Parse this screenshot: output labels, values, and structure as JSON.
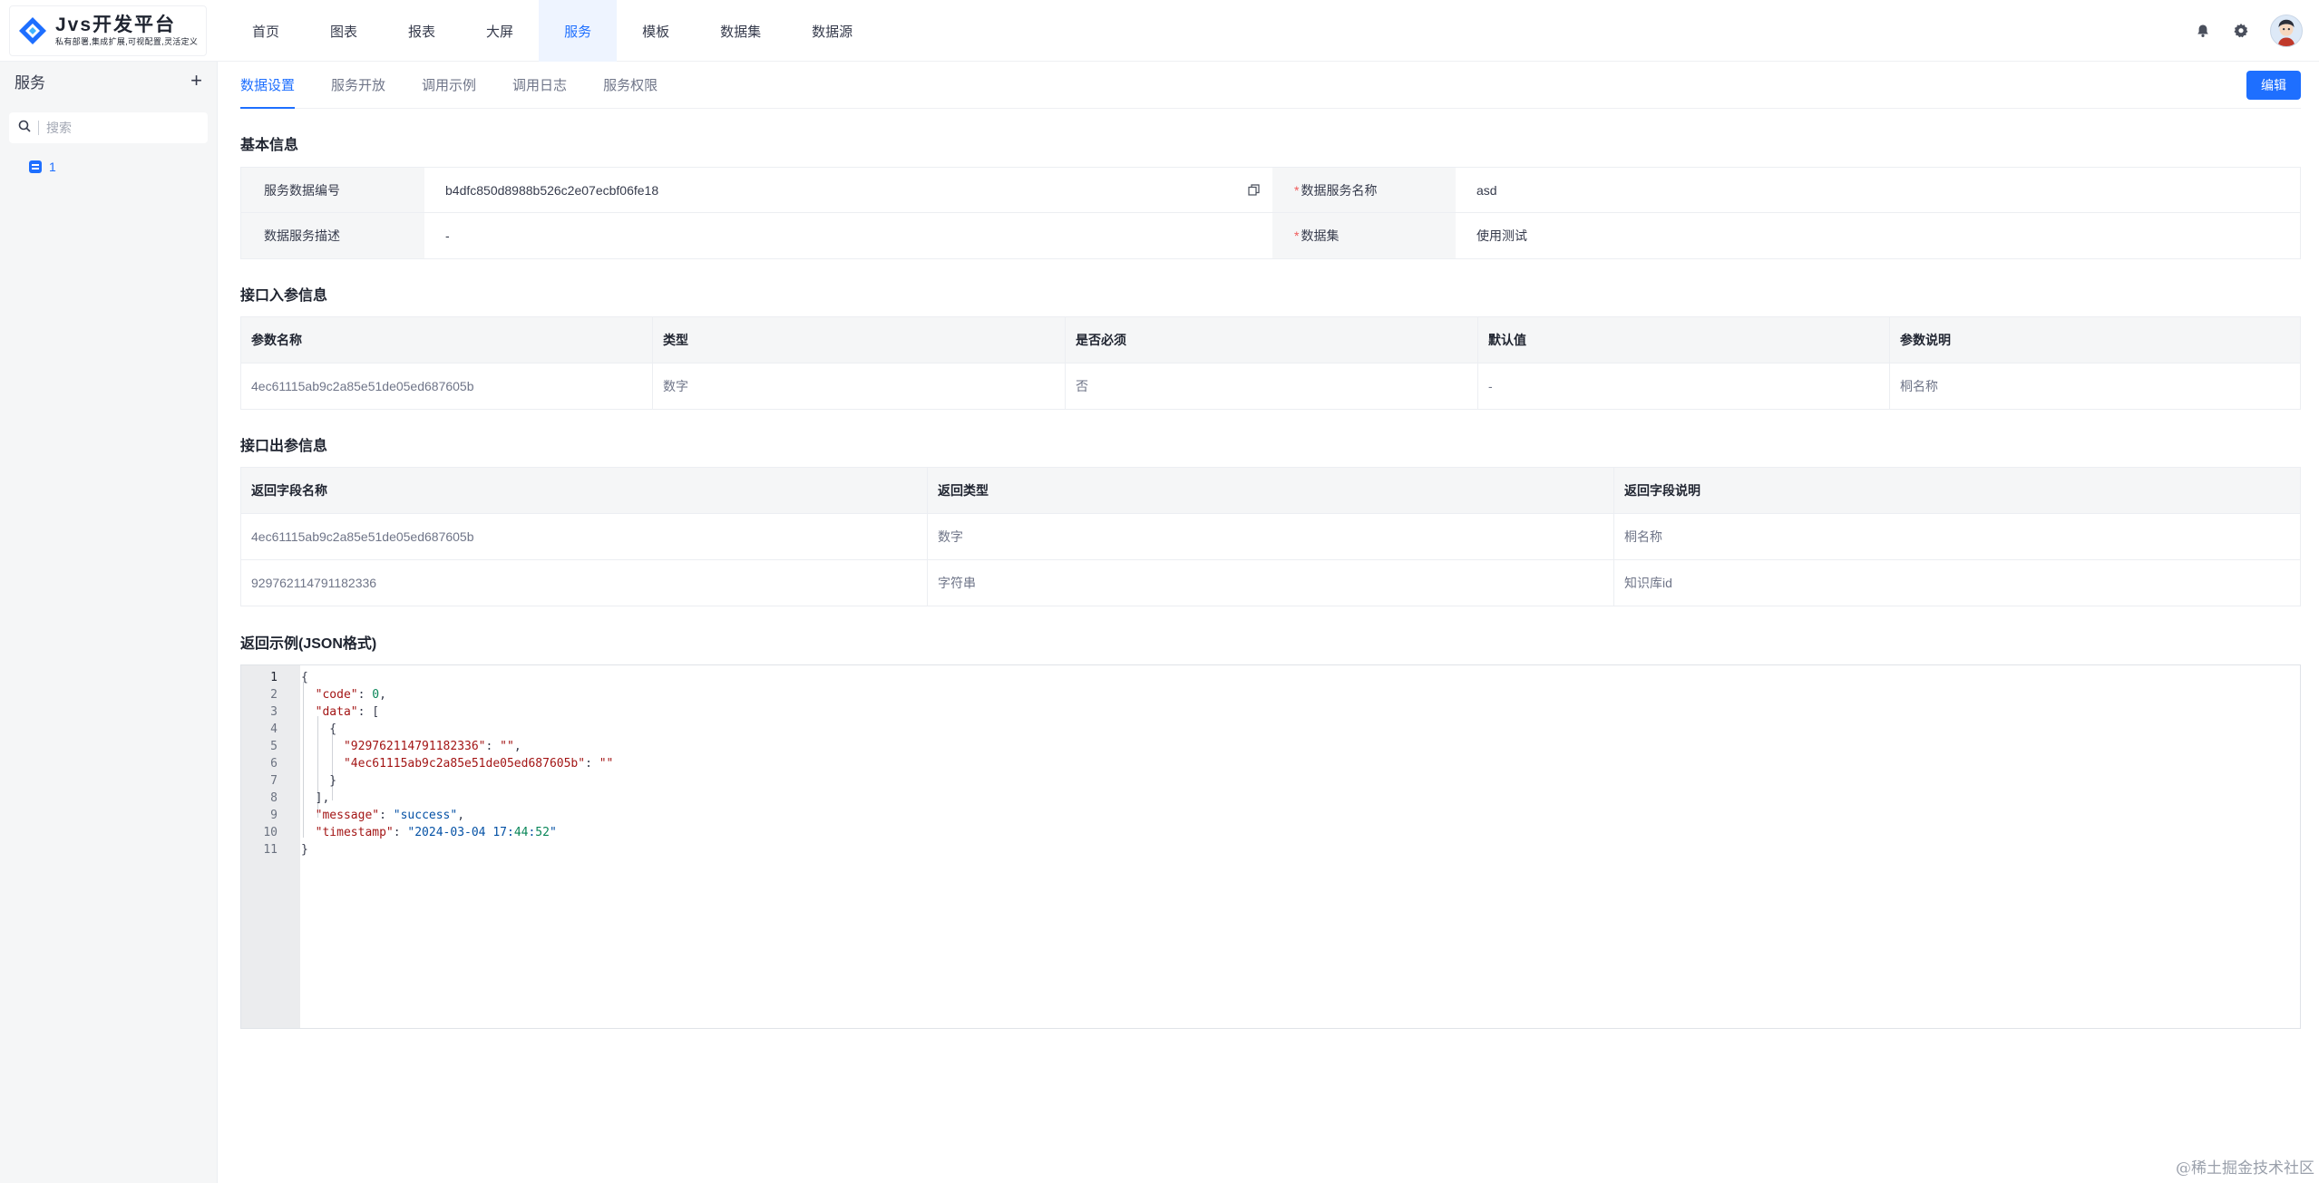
{
  "app": {
    "logo_title": "Jvs开发平台",
    "logo_subtitle": "私有部署,集成扩展,可视配置,灵活定义",
    "accent": "#1e6fff"
  },
  "nav": {
    "items": [
      {
        "label": "首页"
      },
      {
        "label": "图表"
      },
      {
        "label": "报表"
      },
      {
        "label": "大屏"
      },
      {
        "label": "服务",
        "active": true
      },
      {
        "label": "模板"
      },
      {
        "label": "数据集"
      },
      {
        "label": "数据源"
      }
    ],
    "icons": [
      "bell-icon",
      "gear-icon",
      "avatar"
    ]
  },
  "sidebar": {
    "title": "服务",
    "add_icon": "plus-icon",
    "search_placeholder": "搜索",
    "items": [
      {
        "label": "1"
      }
    ]
  },
  "tabs": [
    {
      "label": "数据设置",
      "active": true
    },
    {
      "label": "服务开放"
    },
    {
      "label": "调用示例"
    },
    {
      "label": "调用日志"
    },
    {
      "label": "服务权限"
    }
  ],
  "edit_button": "编辑",
  "basic_info": {
    "title": "基本信息",
    "fields": [
      {
        "label": "服务数据编号",
        "value": "b4dfc850d8988b526c2e07ecbf06fe18",
        "required": false
      },
      {
        "label": "数据服务名称",
        "value": "asd",
        "required": true
      },
      {
        "label": "数据服务描述",
        "value": "-",
        "required": false
      },
      {
        "label": "数据集",
        "value": "使用测试",
        "required": true
      }
    ]
  },
  "input_params": {
    "title": "接口入参信息",
    "columns": [
      "参数名称",
      "类型",
      "是否必须",
      "默认值",
      "参数说明"
    ],
    "rows": [
      [
        "4ec61115ab9c2a85e51de05ed687605b",
        "数字",
        "否",
        "-",
        "桐名称"
      ]
    ]
  },
  "output_params": {
    "title": "接口出参信息",
    "columns": [
      "返回字段名称",
      "返回类型",
      "返回字段说明"
    ],
    "rows": [
      [
        "4ec61115ab9c2a85e51de05ed687605b",
        "数字",
        "桐名称"
      ],
      [
        "929762114791182336",
        "字符串",
        "知识库id"
      ]
    ]
  },
  "response_example": {
    "title": "返回示例(JSON格式)",
    "lines": [
      "{",
      "  \"code\": 0,",
      "  \"data\": [",
      "    {",
      "      \"929762114791182336\": \"\",",
      "      \"4ec61115ab9c2a85e51de05ed687605b\": \"\"",
      "    }",
      "  ],",
      "  \"message\": \"success\",",
      "  \"timestamp\": \"2024-03-04 17:44:52\"",
      "}"
    ]
  },
  "watermark": "@稀土掘金技术社区"
}
